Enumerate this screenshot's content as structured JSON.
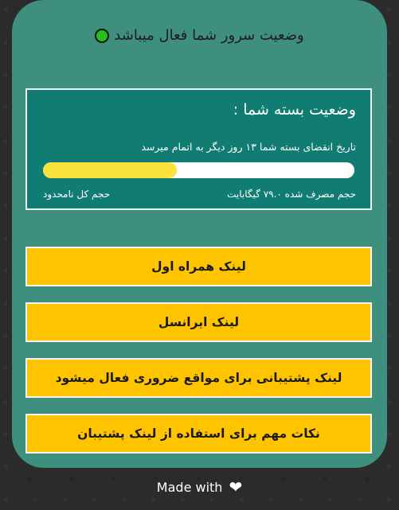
{
  "server_status": {
    "text": "وضعیت سرور شما فعال میباشد",
    "indicator_color": "#22c11f"
  },
  "package": {
    "title": "وضعیت بسته شما :",
    "expiry": "تاریخ انقضای بسته شما  ۱۳ روز دیگر به اتمام میرسد",
    "usage_percent": 43,
    "used": "حجم مصرف شده ۷۹.۰ گیگابایت",
    "total": "حجم کل نامحدود"
  },
  "links": [
    {
      "label": "لینک همراه اول"
    },
    {
      "label": "لینک ایرانسل"
    },
    {
      "label": "لینک پشتیبانی برای مواقع ضروری فعال میشود"
    },
    {
      "label": "نکات مهم برای استفاده از لینک پشتیبان"
    }
  ],
  "footer": {
    "text": "Made with",
    "icon": "heart-icon"
  },
  "colors": {
    "card": "#3f8f7e",
    "package_bg": "#117d72",
    "button": "#ffc400",
    "progress_fill": "#f9e23b"
  }
}
